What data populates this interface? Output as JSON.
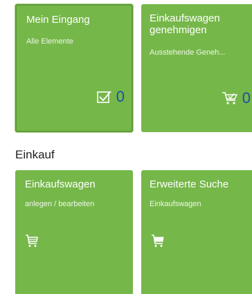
{
  "groups": {
    "top": {
      "tiles": [
        {
          "title": "Mein Eingang",
          "subtitle": "Alle Elemente",
          "count": "0",
          "icon": "checkbox-icon"
        },
        {
          "title": "Einkaufswagen genehmigen",
          "subtitle": "Ausstehende Geneh...",
          "count": "0",
          "icon": "cart-check-icon"
        }
      ]
    },
    "einkauf": {
      "title": "Einkauf",
      "tiles": [
        {
          "title": "Einkaufswagen",
          "subtitle": "anlegen / bearbeiten",
          "icon": "cart-icon"
        },
        {
          "title": "Erweiterte Suche",
          "subtitle": "Einkaufswagen",
          "icon": "cart-full-icon"
        }
      ]
    }
  },
  "colors": {
    "tile": "#76b74a",
    "count": "#1c4fa3"
  }
}
